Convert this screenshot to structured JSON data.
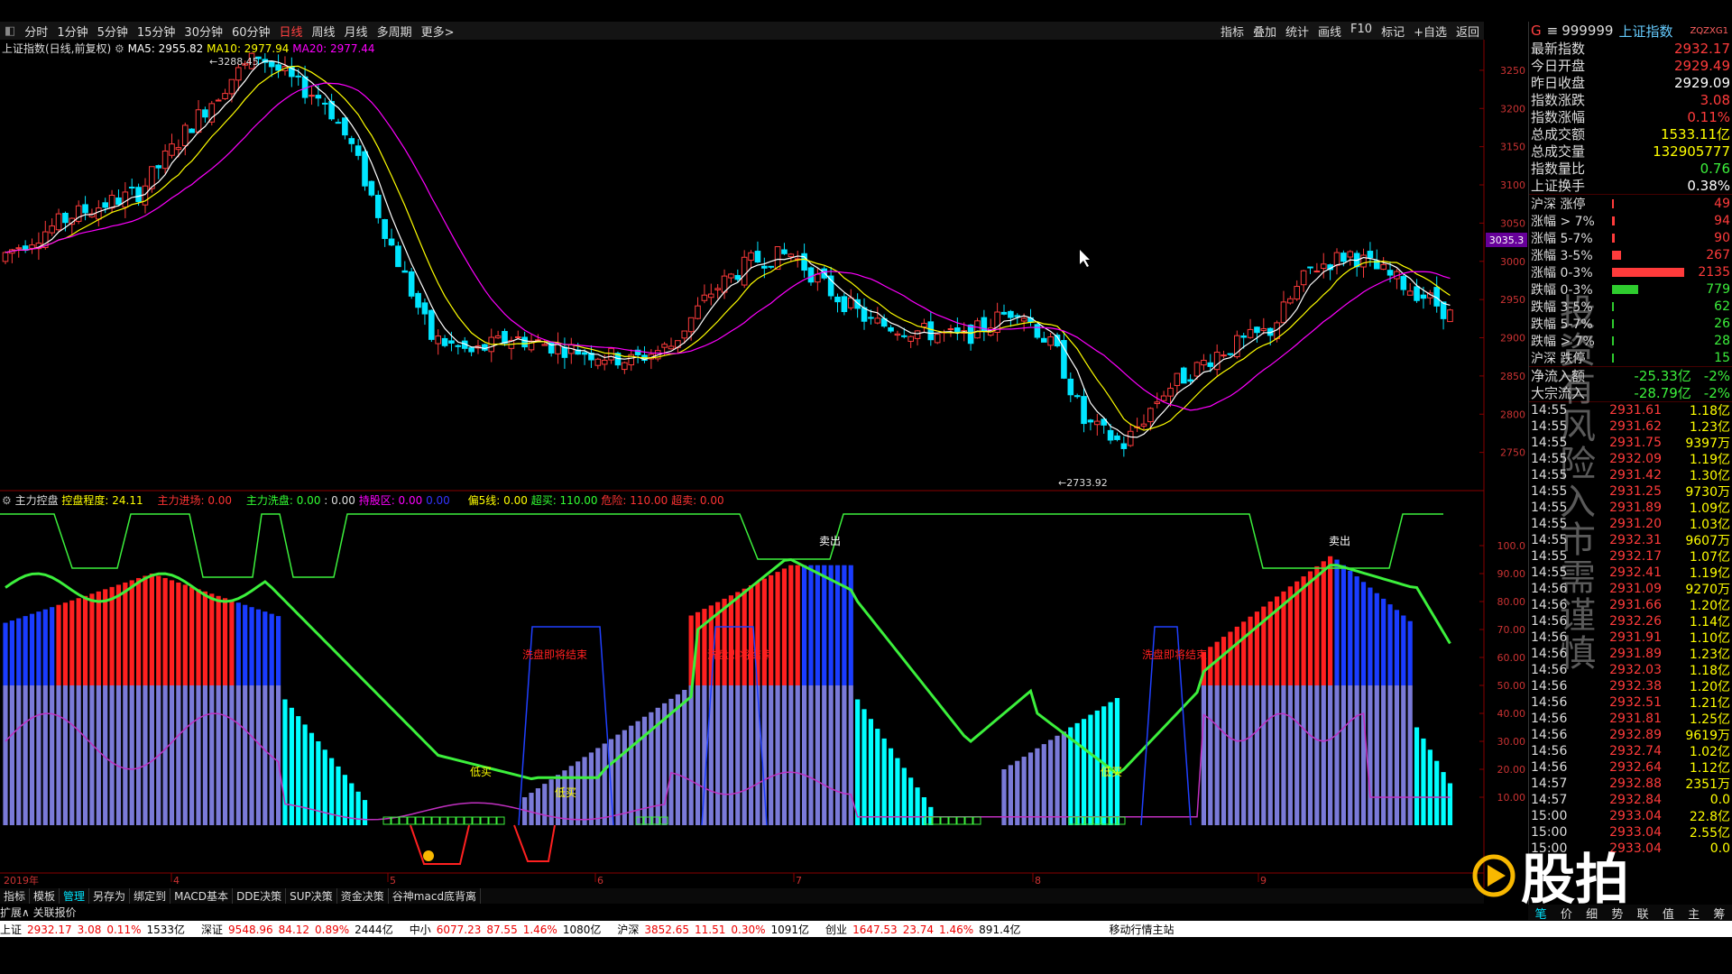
{
  "top_tabs": [
    "分时",
    "1分钟",
    "5分钟",
    "15分钟",
    "30分钟",
    "60分钟",
    "日线",
    "周线",
    "月线",
    "多周期",
    "更多>"
  ],
  "active_tab": "日线",
  "top_right": [
    "指标",
    "叠加",
    "统计",
    "画线",
    "F10",
    "标记",
    "+自选",
    "返回"
  ],
  "main_indicator": {
    "title": "上证指数(日线,前复权)",
    "ma5": "MA5: 2955.82",
    "ma10": "MA10: 2977.94",
    "ma20": "MA20: 2977.44"
  },
  "sub_indicator": {
    "title": "主力控盘",
    "d1": "控盘程度: 24.11",
    "d2": "主力进场: 0.00",
    "d3": "主力洗盘: 0.00",
    "d4": ": 0.00",
    "d5": "持股区: 0.00",
    "d6": "0.00",
    "d7": "偏5线: 0.00",
    "d8": "超买: 110.00",
    "d9": "危险: 110.00",
    "d10": "超卖: 0.00"
  },
  "chart_labels": {
    "high": "3288.45",
    "low": "2733.92",
    "cursor_price": "3035.3",
    "sell1": "卖出",
    "sell2": "卖出",
    "low_buy1": "低买",
    "low_buy2": "低买",
    "low_buy3": "低买",
    "wash1": "洗盘即将结束",
    "wash2": "洗盘即将结束",
    "wash3": "洗盘即将结束",
    "year": "2019年"
  },
  "price_axis": [
    "3250",
    "3200",
    "3150",
    "3100",
    "3050",
    "3000",
    "2950",
    "2900",
    "2850",
    "2800",
    "2750"
  ],
  "sub_axis": [
    "100.0",
    "90.00",
    "80.00",
    "70.00",
    "60.00",
    "50.00",
    "40.00",
    "30.00",
    "20.00",
    "10.00"
  ],
  "month_labels": [
    "4",
    "5",
    "6",
    "7",
    "8",
    "9"
  ],
  "bottom_tabs": [
    "指标",
    "模板",
    "管理",
    "另存为",
    "绑定到",
    "MACD基本",
    "DDE决策",
    "SUP决策",
    "资金决策",
    "谷神macd底背离"
  ],
  "active_bottom_tab": "管理",
  "expand_label": "扩展∧ 关联报价",
  "status_bar": [
    {
      "name": "上证",
      "price": "2932.17",
      "chg": "3.08",
      "pct": "0.11%",
      "amt": "1533亿"
    },
    {
      "name": "深证",
      "price": "9548.96",
      "chg": "84.12",
      "pct": "0.89%",
      "amt": "2444亿"
    },
    {
      "name": "中小",
      "price": "6077.23",
      "chg": "87.55",
      "pct": "1.46%",
      "amt": "1080亿"
    },
    {
      "name": "沪深",
      "price": "3852.65",
      "chg": "11.51",
      "pct": "0.30%",
      "amt": "1091亿"
    },
    {
      "name": "创业",
      "price": "1647.53",
      "chg": "23.74",
      "pct": "1.46%",
      "amt": "891.4亿"
    }
  ],
  "status_tail": "移动行情主站",
  "right_panel": {
    "g": "G",
    "code": "999999",
    "name": "上证指数",
    "small": "ZQZXG1",
    "stats": [
      {
        "label": "最新指数",
        "value": "2932.17",
        "color": "red"
      },
      {
        "label": "今日开盘",
        "value": "2929.49",
        "color": "red"
      },
      {
        "label": "昨日收盘",
        "value": "2929.09",
        "color": "wht"
      },
      {
        "label": "指数涨跌",
        "value": "3.08",
        "color": "red"
      },
      {
        "label": "指数涨幅",
        "value": "0.11%",
        "color": "red"
      },
      {
        "label": "总成交额",
        "value": "1533.11亿",
        "color": "yel"
      },
      {
        "label": "总成交量",
        "value": "132905777",
        "color": "yel"
      },
      {
        "label": "指数量比",
        "value": "0.76",
        "color": "grn"
      },
      {
        "label": "上证换手",
        "value": "0.38%",
        "color": "wht"
      }
    ],
    "breadth": [
      {
        "label": "沪深 涨停",
        "value": "49",
        "color": "red",
        "bar": 0.01
      },
      {
        "label": "涨幅 > 7%",
        "value": "94",
        "color": "red",
        "bar": 0.04
      },
      {
        "label": "涨幅 5-7%",
        "value": "90",
        "color": "red",
        "bar": 0.04
      },
      {
        "label": "涨幅 3-5%",
        "value": "267",
        "color": "red",
        "bar": 0.12
      },
      {
        "label": "涨幅 0-3%",
        "value": "2135",
        "color": "red",
        "bar": 1.0
      },
      {
        "label": "跌幅 0-3%",
        "value": "779",
        "color": "grn",
        "bar": 0.36
      },
      {
        "label": "跌幅 3-5%",
        "value": "62",
        "color": "grn",
        "bar": 0.03
      },
      {
        "label": "跌幅 5-7%",
        "value": "26",
        "color": "grn",
        "bar": 0.01
      },
      {
        "label": "跌幅 > 7%",
        "value": "28",
        "color": "grn",
        "bar": 0.01
      },
      {
        "label": "沪深 跌停",
        "value": "15",
        "color": "grn",
        "bar": 0.01
      }
    ],
    "flows": [
      {
        "label": "净流入额",
        "value": "-25.33亿",
        "pct": "-2%"
      },
      {
        "label": "大宗流入",
        "value": "-28.79亿",
        "pct": "-2%"
      }
    ],
    "ticks": [
      [
        "14:55",
        "2931.61",
        "1.18亿"
      ],
      [
        "14:55",
        "2931.62",
        "1.23亿"
      ],
      [
        "14:55",
        "2931.75",
        "9397万"
      ],
      [
        "14:55",
        "2932.09",
        "1.19亿"
      ],
      [
        "14:55",
        "2931.42",
        "1.30亿"
      ],
      [
        "14:55",
        "2931.25",
        "9730万"
      ],
      [
        "14:55",
        "2931.89",
        "1.09亿"
      ],
      [
        "14:55",
        "2931.20",
        "1.03亿"
      ],
      [
        "14:55",
        "2932.31",
        "9607万"
      ],
      [
        "14:55",
        "2932.17",
        "1.07亿"
      ],
      [
        "14:55",
        "2932.41",
        "1.19亿"
      ],
      [
        "14:56",
        "2931.09",
        "9270万"
      ],
      [
        "14:56",
        "2931.66",
        "1.20亿"
      ],
      [
        "14:56",
        "2932.26",
        "1.14亿"
      ],
      [
        "14:56",
        "2931.91",
        "1.10亿"
      ],
      [
        "14:56",
        "2931.89",
        "1.23亿"
      ],
      [
        "14:56",
        "2932.03",
        "1.18亿"
      ],
      [
        "14:56",
        "2932.38",
        "1.20亿"
      ],
      [
        "14:56",
        "2932.51",
        "1.21亿"
      ],
      [
        "14:56",
        "2931.81",
        "1.25亿"
      ],
      [
        "14:56",
        "2932.89",
        "9619万"
      ],
      [
        "14:56",
        "2932.74",
        "1.02亿"
      ],
      [
        "14:56",
        "2932.64",
        "1.12亿"
      ],
      [
        "14:57",
        "2932.88",
        "2351万"
      ],
      [
        "14:57",
        "2932.84",
        "0.0"
      ],
      [
        "15:00",
        "2933.04",
        "22.8亿"
      ],
      [
        "15:00",
        "2933.04",
        "2.55亿"
      ],
      [
        "15:00",
        "2933.04",
        "0.0"
      ]
    ],
    "tabs": [
      "笔",
      "价",
      "细",
      "势",
      "联",
      "值",
      "主",
      "筹"
    ]
  },
  "watermark": "投资有风险入市需谨慎",
  "logo": "股拍"
}
